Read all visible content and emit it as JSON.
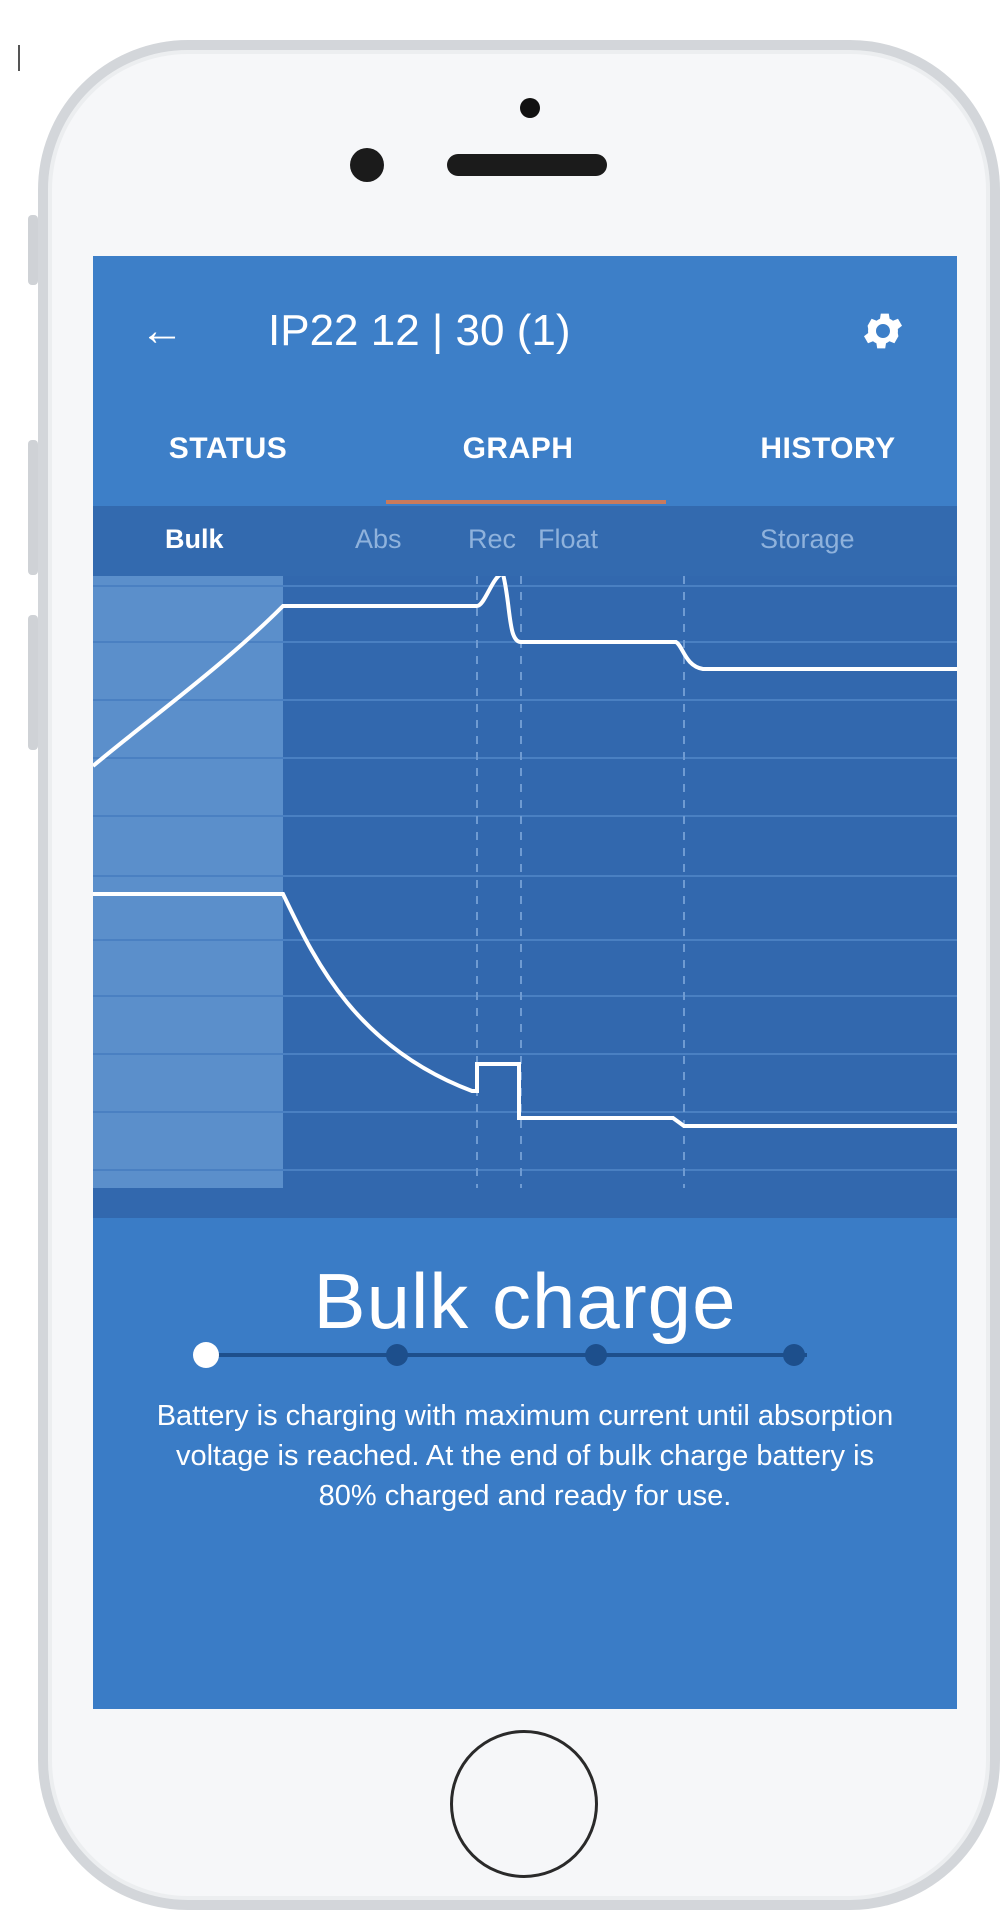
{
  "app_bar": {
    "back_icon": "arrow-left-icon",
    "title": "IP22 12 | 30 (1)",
    "settings_icon": "gear-icon"
  },
  "tabs": [
    {
      "label": "STATUS",
      "selected": false
    },
    {
      "label": "GRAPH",
      "selected": true
    },
    {
      "label": "HISTORY",
      "selected": false
    }
  ],
  "graph": {
    "phases": [
      {
        "label": "Bulk",
        "active": true
      },
      {
        "label": "Abs",
        "active": false
      },
      {
        "label": "Rec",
        "active": false
      },
      {
        "label": "Float",
        "active": false
      },
      {
        "label": "Storage",
        "active": false
      }
    ]
  },
  "description": {
    "title": "Bulk charge",
    "step_active": 1,
    "step_count": 4,
    "text": "Battery is charging with maximum current until absorption voltage is reached. At the end of bulk charge battery is 80% charged and ready for use."
  },
  "colors": {
    "accent": "#3d7fc8",
    "tab_indicator": "#c97a5c",
    "graph_bg": "#3268ae",
    "highlight": "#ffffff"
  }
}
